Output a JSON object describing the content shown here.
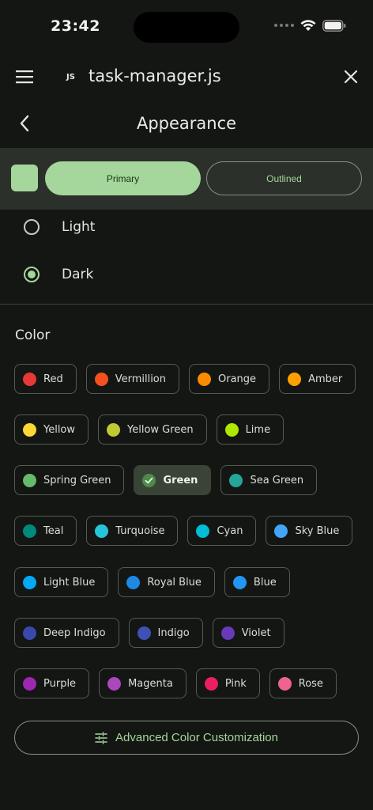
{
  "status": {
    "time": "23:42"
  },
  "app_bar": {
    "badge": "JS",
    "file_name": "task-manager.js"
  },
  "header": {
    "title": "Appearance"
  },
  "preview": {
    "primary_label": "Primary",
    "outlined_label": "Outlined",
    "accent": "#a5d69b"
  },
  "theme_options": [
    {
      "label": "Light",
      "selected": false
    },
    {
      "label": "Dark",
      "selected": true
    }
  ],
  "color_section": {
    "title": "Color",
    "rows": [
      [
        {
          "label": "Red",
          "color": "#e53935"
        },
        {
          "label": "Vermillion",
          "color": "#f4511e"
        },
        {
          "label": "Orange",
          "color": "#fb8c00"
        },
        {
          "label": "Amber",
          "color": "#ffa000"
        }
      ],
      [
        {
          "label": "Yellow",
          "color": "#fdd835"
        },
        {
          "label": "Yellow Green",
          "color": "#c0ca33"
        },
        {
          "label": "Lime",
          "color": "#aeea00"
        }
      ],
      [
        {
          "label": "Spring Green",
          "color": "#66bb6a"
        },
        {
          "label": "Green",
          "color": "#4e8a4a",
          "selected": true
        },
        {
          "label": "Sea Green",
          "color": "#26a69a"
        }
      ],
      [
        {
          "label": "Teal",
          "color": "#00897b"
        },
        {
          "label": "Turquoise",
          "color": "#26c6da"
        },
        {
          "label": "Cyan",
          "color": "#00bcd4"
        },
        {
          "label": "Sky Blue",
          "color": "#42a5f5"
        }
      ],
      [
        {
          "label": "Light Blue",
          "color": "#03a9f4"
        },
        {
          "label": "Royal Blue",
          "color": "#1e88e5"
        },
        {
          "label": "Blue",
          "color": "#2196f3"
        }
      ],
      [
        {
          "label": "Deep Indigo",
          "color": "#3949ab"
        },
        {
          "label": "Indigo",
          "color": "#3f51b5"
        },
        {
          "label": "Violet",
          "color": "#673ab7"
        }
      ],
      [
        {
          "label": "Purple",
          "color": "#9c27b0"
        },
        {
          "label": "Magenta",
          "color": "#ab47bc"
        },
        {
          "label": "Pink",
          "color": "#e91e63"
        },
        {
          "label": "Rose",
          "color": "#f06292"
        }
      ]
    ]
  },
  "advanced_button": {
    "label": "Advanced Color Customization"
  }
}
